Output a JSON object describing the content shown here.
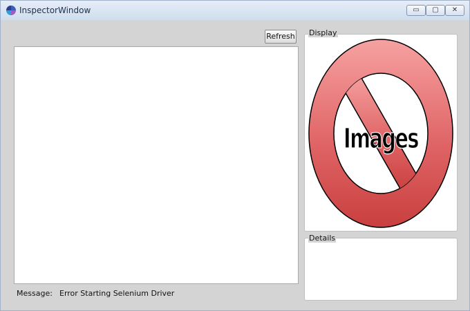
{
  "window": {
    "title": "InspectorWindow",
    "buttons": {
      "minimize": "▭",
      "maximize": "▢",
      "close": "✕"
    }
  },
  "toolbar": {
    "refresh_label": "Refresh"
  },
  "display": {
    "label": "Display",
    "placeholder_text": "Images",
    "icon": "no-images-icon",
    "colors": {
      "ring": "#e06566",
      "ring_dark": "#c93f3f",
      "outline": "#000000"
    }
  },
  "details": {
    "label": "Details"
  },
  "status": {
    "label": "Message:",
    "value": "Error Starting Selenium Driver"
  }
}
